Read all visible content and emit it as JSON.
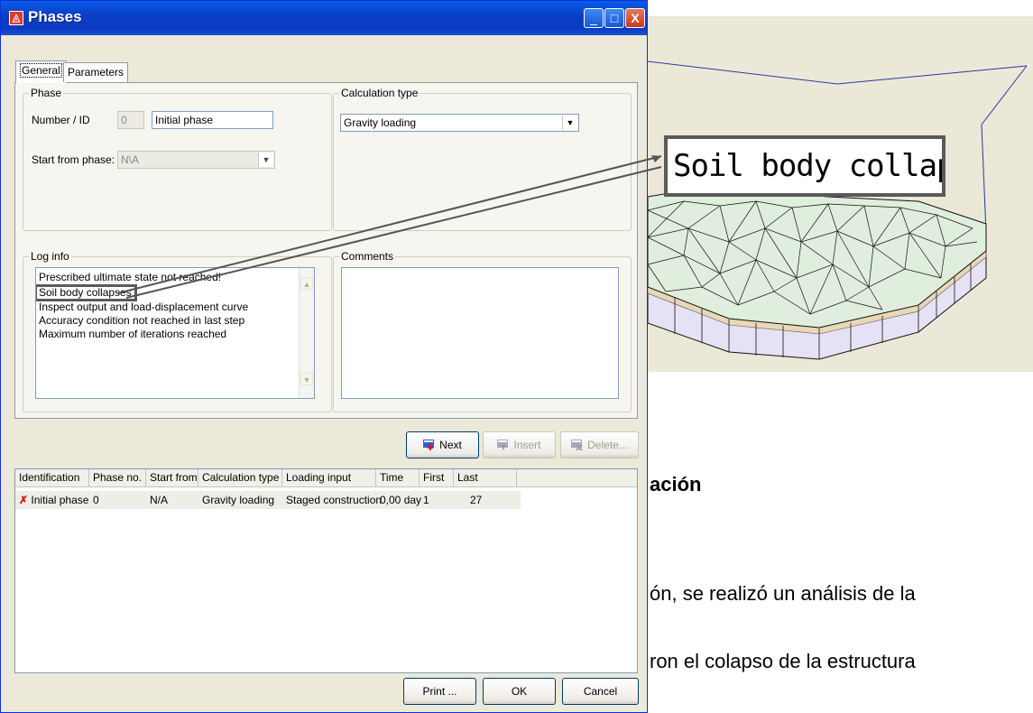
{
  "dialog": {
    "title": "Phases",
    "controls": {
      "minimize": "_",
      "maximize": "□",
      "close": "X"
    }
  },
  "tabs": [
    {
      "label": "General",
      "selected": true
    },
    {
      "label": "Parameters",
      "selected": false
    }
  ],
  "phase_group": {
    "legend": "Phase",
    "number_label": "Number / ID",
    "number_value": "0",
    "id_value": "Initial phase",
    "start_label": "Start from phase:",
    "start_value": "N\\A"
  },
  "calc_group": {
    "legend": "Calculation type",
    "value": "Gravity loading"
  },
  "log_group": {
    "legend": "Log info",
    "lines": [
      "Prescribed ultimate state not reached!",
      "Soil body collapses",
      "Inspect output and load-displacement curve",
      "Accuracy condition not reached in last step",
      "Maximum number of iterations reached"
    ]
  },
  "comments_group": {
    "legend": "Comments",
    "value": ""
  },
  "actions": {
    "next": "Next",
    "insert": "Insert",
    "delete": "Delete..."
  },
  "table": {
    "columns": [
      "Identification",
      "Phase no.",
      "Start from",
      "Calculation type",
      "Loading input",
      "Time",
      "First",
      "Last"
    ],
    "rows": [
      {
        "identification": "Initial phase",
        "phase_no": "0",
        "start_from": "N/A",
        "calc_type": "Gravity loading",
        "loading_input": "Staged construction",
        "time": "0,00 day",
        "first": "1",
        "last": "27"
      }
    ]
  },
  "footer": {
    "print": "Print ...",
    "ok": "OK",
    "cancel": "Cancel"
  },
  "figure": {
    "callout": "Soil body collapses"
  },
  "document": {
    "heading": "ación",
    "line1": "ón, se realizó un análisis de la",
    "line2": "ron el colapso de la estructura"
  },
  "colors": {
    "titlebar": "#0a4fd4",
    "mesh_top": "#dfeedd",
    "mesh_side": "#e6e2f5",
    "error_mark": "#e01010"
  }
}
